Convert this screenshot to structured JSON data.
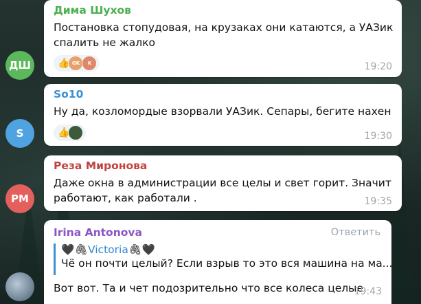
{
  "messages": [
    {
      "sender": "Дима Шухов",
      "sender_color": "#4caf50",
      "text_lines": [
        "Постановка стопудовая, на крузаках они катаются, а УАЗик",
        "спалить не жалко"
      ],
      "time": "19:20",
      "avatar": {
        "initials": "ДШ",
        "color": "#5cb85c"
      },
      "reactions": {
        "emoji": "👍",
        "avatars": [
          {
            "label": "GK",
            "color": "#e8a06a"
          },
          {
            "label": "K",
            "color": "#e0876a"
          }
        ]
      }
    },
    {
      "sender": "So10",
      "sender_color": "#3a8fd6",
      "text_lines": [
        "Ну да, козломордые взорвали УАЗик. Сепары, бегите нахен"
      ],
      "time": "19:30",
      "avatar": {
        "initials": "S",
        "color": "#4fa3e0"
      },
      "reactions": {
        "emoji": "👍",
        "avatars": [
          {
            "label": "",
            "color": "#3d5a3a"
          }
        ]
      }
    },
    {
      "sender": "Реза Миронова",
      "sender_color": "#c0433f",
      "text_lines": [
        "Даже окна в администрации все целы и свет горит. Значит",
        "работают, как работали ."
      ],
      "time": "19:35",
      "avatar": {
        "initials": "РМ",
        "color": "#e4605d"
      }
    },
    {
      "sender": "Irina Antonova",
      "sender_color": "#8a56c6",
      "reply_label": "Ответить",
      "quote": {
        "name_prefix": "🖤🖇",
        "name": "Victoria",
        "name_suffix": "🖇🖤",
        "text": "Чё он почти целый? Если взрыв то это вся машина на ма..."
      },
      "text_lines": [
        "Вот вот. Та и чет подозрительно что все колеса целые"
      ],
      "time": "19:43",
      "avatar": {
        "initials": "",
        "color": "#7a8fa0"
      }
    }
  ]
}
